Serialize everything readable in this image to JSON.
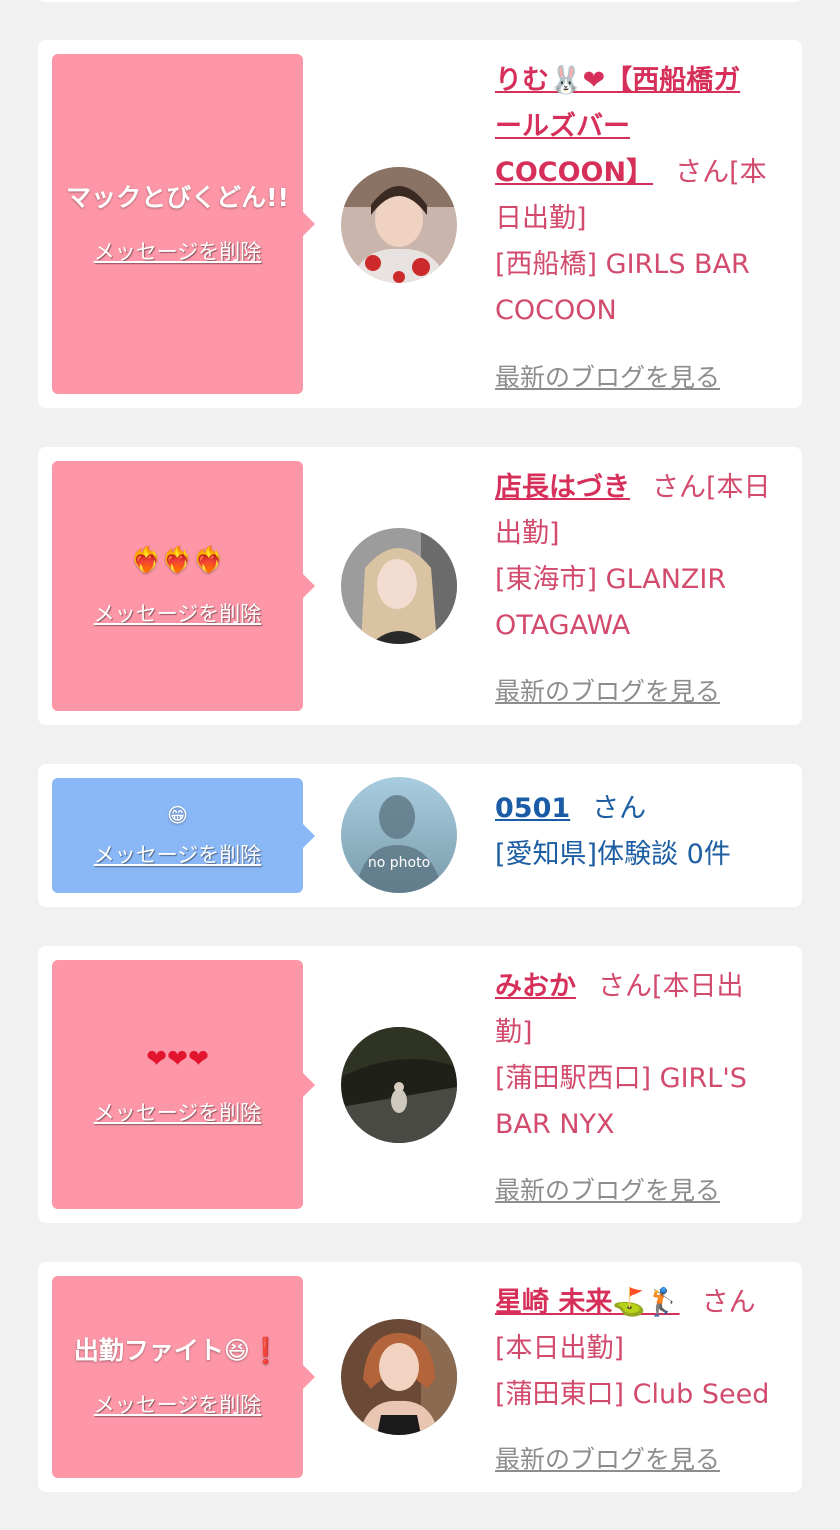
{
  "delete_label": "メッセージを削除",
  "blog_label": "最新のブログを見る",
  "entries": [
    {
      "message": "マックとびくどん!!",
      "name": "りむ🐰❤【西船橋ガールズバーCOCOON】",
      "name_lines": [
        "りむ🐰❤【西船橋ガ",
        "ールズバー",
        "COCOON】"
      ],
      "suffix": "さん[本日出勤]",
      "suffix_lines": [
        "さん[本",
        "日出勤]"
      ],
      "shop": "[西船橋] GIRLS BAR COCOON",
      "shop_lines": [
        "[西船橋] GIRLS BAR",
        "COCOON"
      ],
      "has_blog": true,
      "bubble_color": "pink"
    },
    {
      "message": "❤‍🔥❤‍🔥❤‍🔥",
      "name": "店長はづき",
      "suffix": "さん[本日出勤]",
      "suffix_lines": [
        "さん[本日",
        "出勤]"
      ],
      "shop": "[東海市] GLANZIR OTAGAWA",
      "shop_lines": [
        "[東海市] GLANZIR",
        "OTAGAWA"
      ],
      "has_blog": true,
      "bubble_color": "pink"
    },
    {
      "message": "😁",
      "name": "0501",
      "suffix": "さん",
      "shop": "[愛知県]体験談 0件",
      "avatar_text": "no photo",
      "has_blog": false,
      "bubble_color": "blue"
    },
    {
      "message": "❤❤❤",
      "name": "みおか",
      "suffix": "さん[本日出勤]",
      "suffix_lines": [
        "さん[本日出",
        "勤]"
      ],
      "shop": "[蒲田駅西口] GIRL'S BAR NYX",
      "shop_lines": [
        "[蒲田駅西口] GIRL'S",
        "BAR NYX"
      ],
      "has_blog": true,
      "bubble_color": "pink"
    },
    {
      "message": "出勤ファイト😆❗",
      "name": "星崎 未来⛳🏌",
      "suffix": "さん[本日出勤]",
      "suffix_lines": [
        "さん",
        "[本日出勤]"
      ],
      "shop": "[蒲田東口] Club Seed",
      "has_blog": true,
      "bubble_color": "pink"
    }
  ],
  "colors": {
    "pink_bubble": "#fd97a7",
    "blue_bubble": "#8ab7f6",
    "name_pink": "#d6305a",
    "name_blue": "#1a5ca6"
  }
}
